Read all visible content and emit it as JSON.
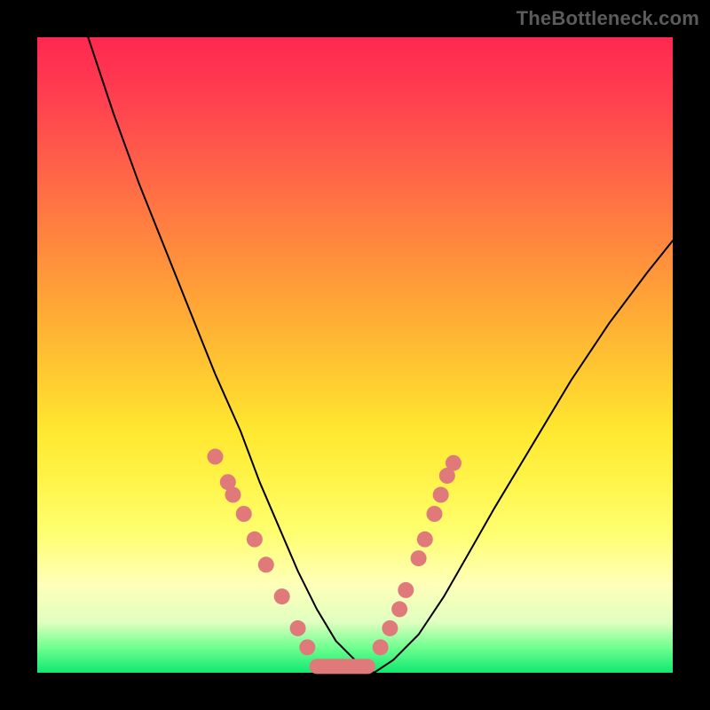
{
  "watermark": "TheBottleneck.com",
  "colors": {
    "dot": "#e07a7a",
    "curve": "#000000",
    "background": "#000000"
  },
  "chart_data": {
    "type": "line",
    "title": "",
    "xlabel": "",
    "ylabel": "",
    "xlim": [
      0,
      100
    ],
    "ylim": [
      0,
      100
    ],
    "grid": false,
    "legend": false,
    "series": [
      {
        "name": "bottleneck-curve",
        "x": [
          8,
          12,
          16,
          20,
          24,
          28,
          32,
          35,
          38,
          41,
          44,
          47,
          50,
          53,
          56,
          60,
          64,
          68,
          72,
          78,
          84,
          90,
          96,
          100
        ],
        "y": [
          100,
          88,
          77,
          67,
          57,
          47,
          38,
          30,
          23,
          16,
          10,
          5,
          2,
          0,
          2,
          6,
          12,
          19,
          26,
          36,
          46,
          55,
          63,
          68
        ],
        "note": "Asymmetric V-shaped bottleneck curve; y=0 at x≈53. Left branch reaches 100, right branch reaches ≈68."
      }
    ],
    "flat_segment": {
      "x_start": 44,
      "x_end": 52,
      "y": 1
    },
    "markers_left": [
      {
        "x": 28.0,
        "y": 34
      },
      {
        "x": 30.0,
        "y": 30
      },
      {
        "x": 30.8,
        "y": 28
      },
      {
        "x": 32.5,
        "y": 25
      },
      {
        "x": 34.2,
        "y": 21
      },
      {
        "x": 36.0,
        "y": 17
      },
      {
        "x": 38.5,
        "y": 12
      },
      {
        "x": 41.0,
        "y": 7
      },
      {
        "x": 42.5,
        "y": 4
      }
    ],
    "markers_right": [
      {
        "x": 54.0,
        "y": 4
      },
      {
        "x": 55.5,
        "y": 7
      },
      {
        "x": 57.0,
        "y": 10
      },
      {
        "x": 58.0,
        "y": 13
      },
      {
        "x": 60.0,
        "y": 18
      },
      {
        "x": 61.0,
        "y": 21
      },
      {
        "x": 62.5,
        "y": 25
      },
      {
        "x": 63.5,
        "y": 28
      },
      {
        "x": 64.5,
        "y": 31
      },
      {
        "x": 65.5,
        "y": 33
      }
    ]
  }
}
